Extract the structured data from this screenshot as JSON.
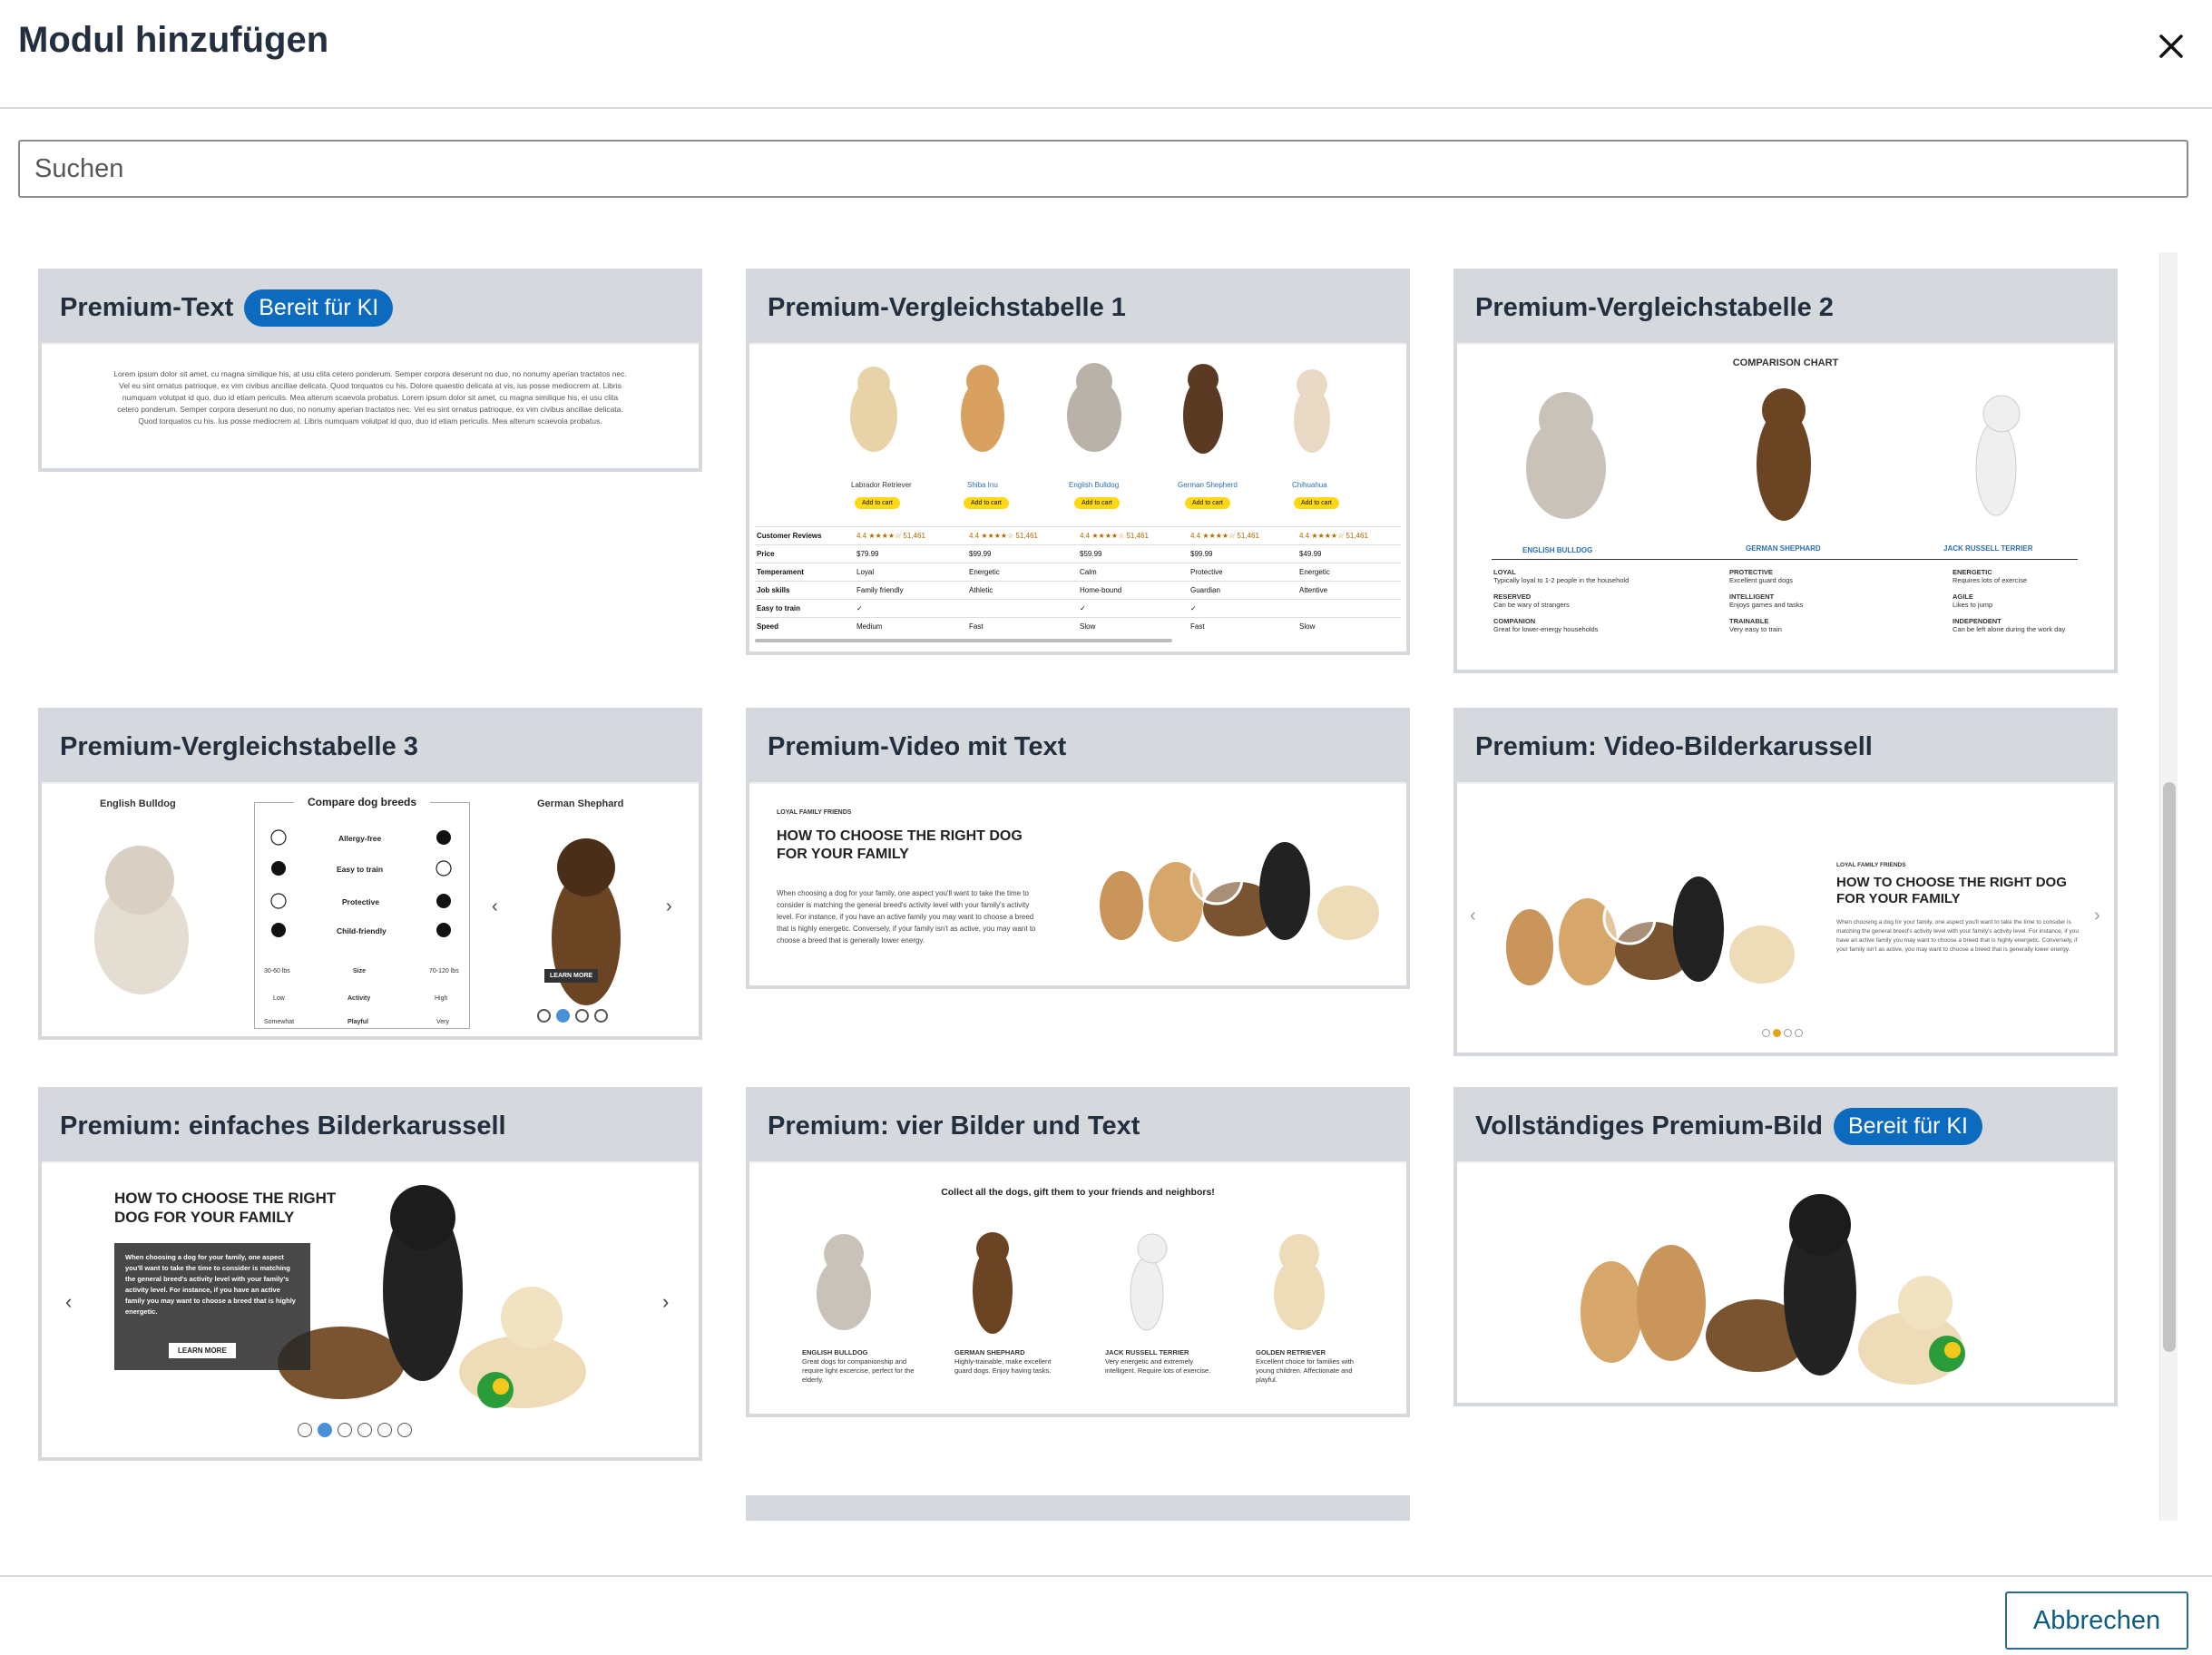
{
  "dialog": {
    "title": "Modul hinzufügen",
    "close_icon": "close-icon"
  },
  "search": {
    "placeholder": "Suchen",
    "value": ""
  },
  "badge_label": "Bereit für KI",
  "cards": [
    {
      "title": "Premium-Text",
      "badge": "Bereit für KI"
    },
    {
      "title": "Premium-Vergleichstabelle 1"
    },
    {
      "title": "Premium-Vergleichstabelle 2"
    },
    {
      "title": "Premium-Vergleichstabelle 3"
    },
    {
      "title": "Premium-Video mit Text"
    },
    {
      "title": "Premium: Video-Bilderkarussell"
    },
    {
      "title": "Premium: einfaches Bilderkarussell"
    },
    {
      "title": "Premium: vier Bilder und Text"
    },
    {
      "title": "Vollständiges Premium-Bild",
      "badge": "Bereit für KI"
    }
  ],
  "previews": {
    "text_lorem": "Lorem ipsum dolor sit amet, cu magna similique his, at usu clita cetero ponderum. Semper corpora deserunt no duo, no nonumy aperian tractatos nec. Vel eu sint ornatus patrioque, ex vim civibus ancillae delicata. Quod torquatos cu his. Dolore quaestio delicata at vis, ius posse mediocrem at. Libris numquam volutpat id quo, duo id etiam periculis. Mea alterum scaevola probatus. Lorem ipsum dolor sit amet, cu magna similique his, ei usu clita cetero ponderum. Semper corpora deserunt no duo, no nonumy aperian tractatos nec. Vel eu sint ornatus patrioque, ex vim civibus ancillae delicata. Quod torquatos cu his. Ius posse mediocrem at. Libris numquam volutpat id quo, duo id etiam periculis. Mea alterum scaevola probatus.",
    "ct1": {
      "breeds": [
        "Labrador Retriever",
        "Shiba Inu",
        "English Bulldog",
        "German Shepherd",
        "Chihuahua"
      ],
      "add_to_cart": "Add to cart",
      "rows": [
        {
          "label": "Customer Reviews",
          "values": [
            "4.4 ★★★★☆ 51,461",
            "4.4 ★★★★☆ 51,461",
            "4.4 ★★★★☆ 51,461",
            "4.4 ★★★★☆ 51,461",
            "4.4 ★★★★☆ 51,461"
          ]
        },
        {
          "label": "Price",
          "values": [
            "$79.99",
            "$99.99",
            "$59.99",
            "$99.99",
            "$49.99"
          ]
        },
        {
          "label": "Temperament",
          "values": [
            "Loyal",
            "Energetic",
            "Calm",
            "Protective",
            "Energetic"
          ]
        },
        {
          "label": "Job skills",
          "values": [
            "Family friendly",
            "Athletic",
            "Home-bound",
            "Guardian",
            "Attentive"
          ]
        },
        {
          "label": "Easy to train",
          "values": [
            "✓",
            "",
            "✓",
            "✓",
            ""
          ]
        },
        {
          "label": "Speed",
          "values": [
            "Medium",
            "Fast",
            "Slow",
            "Fast",
            "Slow"
          ]
        }
      ]
    },
    "ct2": {
      "heading": "COMPARISON CHART",
      "breeds": [
        "ENGLISH BULLDOG",
        "GERMAN SHEPHARD",
        "JACK RUSSELL TERRIER"
      ],
      "traits": [
        [
          [
            "LOYAL",
            "Typically loyal to 1-2 people in the household"
          ],
          [
            "RESERVED",
            "Can be wary of strangers"
          ],
          [
            "COMPANION",
            "Great for lower-energy households"
          ]
        ],
        [
          [
            "PROTECTIVE",
            "Excellent guard dogs"
          ],
          [
            "INTELLIGENT",
            "Enjoys games and tasks"
          ],
          [
            "TRAINABLE",
            "Very easy to train"
          ]
        ],
        [
          [
            "ENERGETIC",
            "Requires lots of exercise"
          ],
          [
            "AGILE",
            "Likes to jump"
          ],
          [
            "INDEPENDENT",
            "Can be left alone during the work day"
          ]
        ]
      ]
    },
    "ct3": {
      "left_name": "English Bulldog",
      "right_name": "German Shephard",
      "heading": "Compare dog breeds",
      "rows": [
        "Allergy-free",
        "Easy to train",
        "Protective",
        "Child-friendly"
      ],
      "size": [
        "30-60 lbs",
        "Size",
        "70-120 lbs"
      ],
      "activity": [
        "Low",
        "Activity",
        "High"
      ],
      "playful": [
        "Somewhat",
        "Playful",
        "Very"
      ],
      "learn_more": "LEARN MORE"
    },
    "video_text": {
      "kicker": "LOYAL FAMILY FRIENDS",
      "heading": "HOW TO CHOOSE THE RIGHT DOG FOR YOUR FAMILY",
      "body": "When choosing a dog for your family, one aspect you'll want to take the time to consider is matching the general breed's activity level with your family's activity level. For instance, if you have an active family you may want to choose a breed that is highly energetic. Conversely, if your family isn't as active, you may want to choose a breed that is generally lower energy."
    },
    "video_carousel": {
      "kicker": "LOYAL FAMILY FRIENDS",
      "heading": "HOW TO CHOOSE THE RIGHT DOG FOR YOUR FAMILY",
      "body": "When choosing a dog for your family, one aspect you'll want to take the time to consider is matching the general breed's activity level with your family's activity level. For instance, if you have an active family you may want to choose a breed that is highly energetic. Conversely, if your family isn't as active, you may want to choose a breed that is generally lower energy."
    },
    "simple_carousel": {
      "heading": "HOW TO CHOOSE THE RIGHT DOG FOR YOUR FAMILY",
      "body": "When choosing a dog for your family, one aspect you'll want to take the time to consider is matching the general breed's activity level with your family's activity level. For instance, if you have an active family you may want to choose a breed that is highly energetic.",
      "learn_more": "LEARN MORE"
    },
    "four_images": {
      "heading": "Collect all the dogs, gift them to your friends and neighbors!",
      "items": [
        {
          "name": "ENGLISH BULLDOG",
          "text": "Great dogs for companionship and require light excercise, perfect for the elderly."
        },
        {
          "name": "GERMAN SHEPHARD",
          "text": "Highly-trainable, make excellent guard dogs. Enjoy having tasks."
        },
        {
          "name": "JACK RUSSELL TERRIER",
          "text": "Very energetic and extremely intelligent. Require lots of exercise."
        },
        {
          "name": "GOLDEN RETRIEVER",
          "text": "Excellent choice for families with young children. Affectionate and playful."
        }
      ]
    }
  },
  "footer": {
    "cancel_label": "Abbrechen"
  },
  "colors": {
    "accent": "#0d6bbf",
    "card_header": "#d5d9dd",
    "pager_active": "#4a90d9"
  }
}
